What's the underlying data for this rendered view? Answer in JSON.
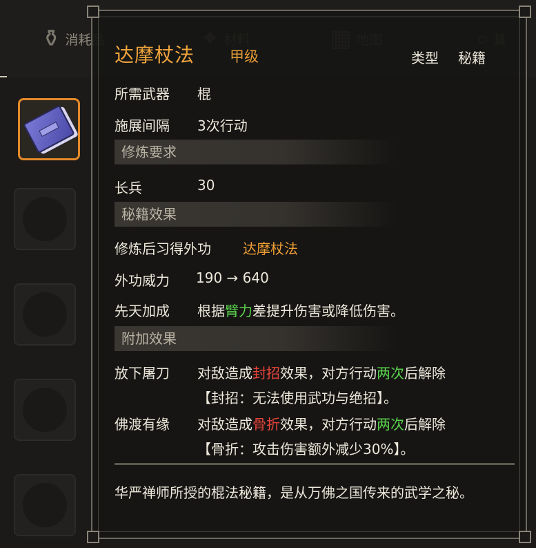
{
  "tabs": [
    {
      "label": "消耗品",
      "icon": "potion-icon"
    },
    {
      "label": "材料",
      "icon": "materials-icon"
    },
    {
      "label": "地图",
      "icon": "map-icon"
    },
    {
      "label": "其",
      "icon": "magnifier-icon"
    }
  ],
  "item": {
    "name": "达摩杖法",
    "grade": "甲级",
    "type_label": "类型",
    "type_value": "秘籍",
    "weapon_label": "所需武器",
    "weapon_value": "棍",
    "interval_label": "施展间隔",
    "interval_value": "3次行动"
  },
  "sections": {
    "requirement": "修炼要求",
    "effect": "秘籍效果",
    "bonus": "附加效果"
  },
  "requirement": {
    "label": "长兵",
    "value": "30"
  },
  "effect": {
    "learn_label": "修炼后习得外功",
    "learn_value": "达摩杖法",
    "power_label": "外功威力",
    "power_value": "190 → 640",
    "innate_label": "先天加成",
    "innate_pre": "根据",
    "innate_attr": "臂力",
    "innate_post": "差提升伤害或降低伤害。"
  },
  "bonus": [
    {
      "name": "放下屠刀",
      "pre": "对敌造成",
      "status": "封招",
      "mid": "效果，对方行动",
      "count": "两次",
      "post": "后解除",
      "detail": "【封招：无法使用武功与绝招】。"
    },
    {
      "name": "佛渡有缘",
      "pre": "对敌造成",
      "status": "骨折",
      "mid": "效果，对方行动",
      "count": "两次",
      "post": "后解除",
      "detail": "【骨折：攻击伤害额外减少30%】。"
    }
  ],
  "description": "华严禅师所授的棍法秘籍，是从万佛之国传来的武学之秘。",
  "colors": {
    "gold": "#ef9f35",
    "green": "#59d24c",
    "red": "#e6443b",
    "selected_border": "#e58a2a"
  }
}
